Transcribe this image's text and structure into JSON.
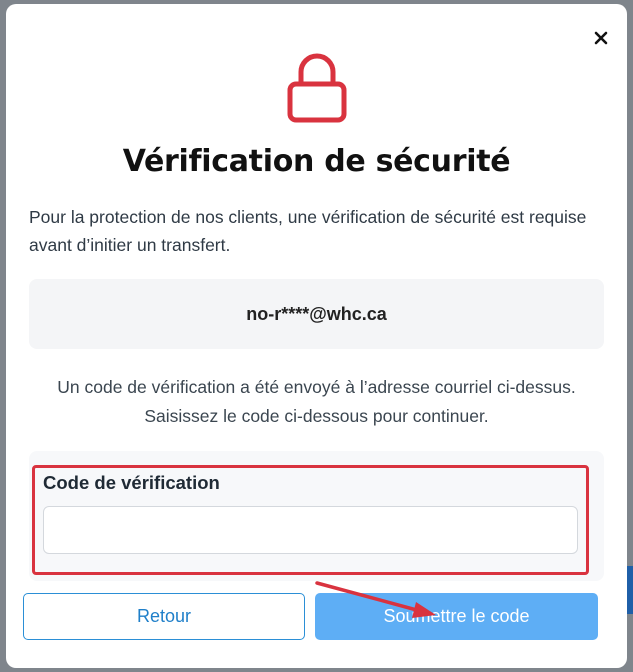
{
  "modal": {
    "title": "Vérification de sécurité",
    "intro": "Pour la protection de nos clients, une vérification de sécurité est requise avant d’initier un transfert.",
    "masked_email": "no-r****@whc.ca",
    "info": "Un code de vérification a été envoyé à l’adresse courriel ci-dessus. Saisissez le code ci-dessous pour continuer.",
    "code_label": "Code de vérification",
    "code_value": "",
    "back_label": "Retour",
    "submit_label": "Soumettre le code"
  },
  "icons": {
    "lock": "lock-icon",
    "close": "close-icon",
    "annotation_arrow": "arrow-icon"
  },
  "colors": {
    "lock": "#d9333f",
    "highlight": "#d9333f",
    "primary": "#5eaef5",
    "secondary_border": "#2b8fd6"
  }
}
